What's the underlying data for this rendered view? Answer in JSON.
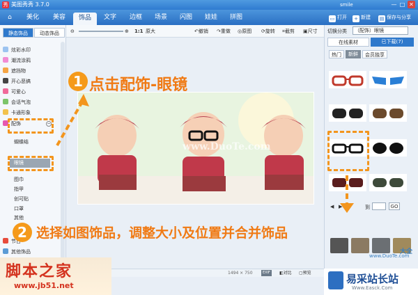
{
  "app": {
    "title": "美图秀秀 3.7.0",
    "user": "smile",
    "win_min": "—",
    "win_max": "□",
    "win_close": "✕"
  },
  "menu": {
    "tabs": [
      "美化",
      "美容",
      "饰品",
      "文字",
      "边框",
      "场景",
      "闪图",
      "娃娃",
      "拼图"
    ],
    "active_tab": "饰品",
    "open": "打开",
    "new": "新建",
    "save_share": "保存与分享"
  },
  "left_panel": {
    "subtabs": [
      "静态饰品",
      "动态饰品"
    ],
    "items": [
      "炫彩水印",
      "潮流涂鸦",
      "遮挡物",
      "开心恶搞",
      "可爱心",
      "会话气泡",
      "卡通形象",
      "配饰",
      "蝴蝶结",
      "眼镜",
      "图巾",
      "指甲",
      "创可贴",
      "口罩",
      "其他"
    ],
    "selected": "眼镜",
    "extra_items": [
      "节日",
      "其他饰品"
    ]
  },
  "toolbar": {
    "zoom_label": "1:1",
    "original_size": "原大",
    "undo": "撤销",
    "redo": "重做",
    "original": "原图",
    "rotate": "旋转",
    "crop": "截剪",
    "resize": "尺寸"
  },
  "photo": {
    "watermark": "www.DuoTe.com"
  },
  "right_panel": {
    "switch_label": "切换分类",
    "category": "（配饰）眼镜",
    "tabs": [
      "在线素材",
      "已下载(7)"
    ],
    "subtabs": [
      "热门",
      "新鲜",
      "会员独享"
    ],
    "page_label": "到",
    "page_go": "GO"
  },
  "status": {
    "dimensions": "1494 × 750",
    "exif": "EXIF",
    "compare": "对比",
    "preview": "预览"
  },
  "annotations": {
    "step1_num": "1",
    "step1_text": "点击配饰-眼镜",
    "step2_num": "2",
    "step2_text": "选择如图饰品，调整大小及位置并合并饰品"
  },
  "watermarks": {
    "jb51_title": "脚本之家",
    "jb51_url": "www.jb51.net",
    "duote": "www.DuoTe.com",
    "yicai": "易采站长站",
    "yicai_sub": "Www.Easck.Com",
    "site_chars": "大全"
  },
  "colors": {
    "accent": "#2f79cc",
    "annotation": "#f3951d"
  }
}
